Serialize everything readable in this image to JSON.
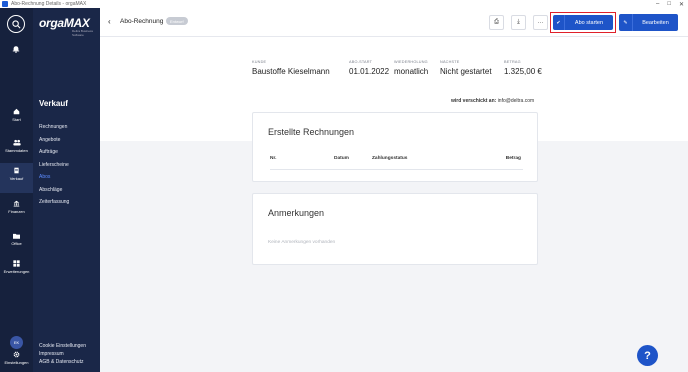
{
  "window": {
    "title": "Abo-Rechnung Details - orgaMAX"
  },
  "rail": {
    "items": [
      {
        "label": "Start",
        "icon": "home-icon"
      },
      {
        "label": "Stammdaten",
        "icon": "people-icon"
      },
      {
        "label": "Verkauf",
        "icon": "invoice-icon"
      },
      {
        "label": "Finanzen",
        "icon": "bank-icon"
      },
      {
        "label": "Office",
        "icon": "folder-icon"
      },
      {
        "label": "Erweiterungen",
        "icon": "grid-icon"
      },
      {
        "label": "Einstellungen",
        "icon": "gear-icon"
      }
    ],
    "avatar_initials": "EK"
  },
  "menu": {
    "logo_orga": "orga",
    "logo_max": "MAX",
    "logo_sub": "Deltra Business Software",
    "section_title": "Verkauf",
    "items": [
      "Rechnungen",
      "Angebote",
      "Aufträge",
      "Lieferscheine",
      "Abos",
      "Abschläge",
      "Zeiterfassung"
    ],
    "active_index": 4,
    "footer": [
      "Cookie Einstellungen",
      "Impressum",
      "AGB & Datenschutz"
    ]
  },
  "header": {
    "back": "‹",
    "title": "Abo-Rechnung",
    "badge": "Entwurf",
    "print": "⎙",
    "download": "⤓",
    "more": "···",
    "start_check": "✔",
    "start_label": "Abo starten",
    "edit_icon": "✎",
    "edit_label": "Bearbeiten"
  },
  "summary": {
    "kunde_key": "KUNDE",
    "kunde_val": "Baustoffe Kieselmann",
    "start_key": "ABO-START",
    "start_val": "01.01.2022",
    "wdh_key": "WIEDERHOLUNG",
    "wdh_val": "monatlich",
    "next_key": "NÄCHSTE",
    "next_val": "Nicht gestartet",
    "amount_key": "BETRAG",
    "amount_val": "1.325,00 €",
    "ship_label": "wird verschickt an:",
    "ship_val": "info@deltra.com"
  },
  "invoices": {
    "title": "Erstellte Rechnungen",
    "columns": [
      "Nr.",
      "Datum",
      "Zahlungsstatus",
      "Betrag"
    ]
  },
  "notes": {
    "title": "Anmerkungen",
    "empty": "Keine Anmerkungen vorhanden"
  },
  "help": {
    "label": "?"
  },
  "colors": {
    "accent": "#1e54c8",
    "sidebar": "#16213d",
    "highlight": "#e0202a"
  }
}
